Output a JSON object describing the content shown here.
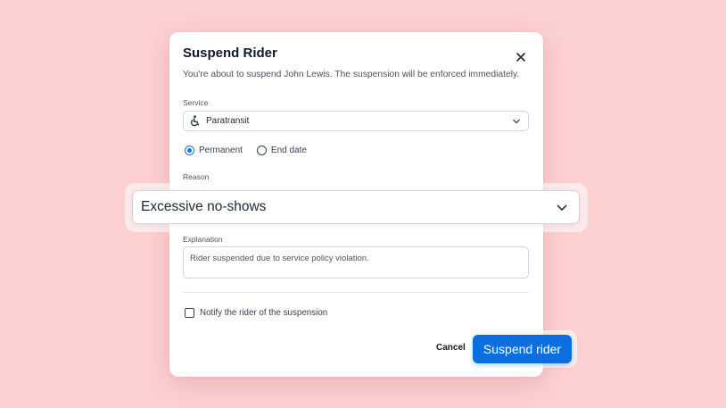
{
  "dialog": {
    "title": "Suspend Rider",
    "description": "You're about to suspend John Lewis. The suspension will be enforced immediately."
  },
  "service": {
    "label": "Service",
    "value": "Paratransit",
    "icon": "wheelchair-icon"
  },
  "duration": {
    "options": [
      {
        "label": "Permanent",
        "checked": true
      },
      {
        "label": "End date",
        "checked": false
      }
    ]
  },
  "reason": {
    "label": "Reason",
    "value": "Excessive no-shows"
  },
  "explanation": {
    "label": "Explanation",
    "value": "Rider suspended due to service policy violation."
  },
  "notify": {
    "label": "Notify the rider of the suspension",
    "checked": false
  },
  "actions": {
    "cancel_label": "Cancel",
    "submit_label": "Suspend rider"
  },
  "colors": {
    "background": "#fdd0d1",
    "accent": "#0b6fe0"
  }
}
